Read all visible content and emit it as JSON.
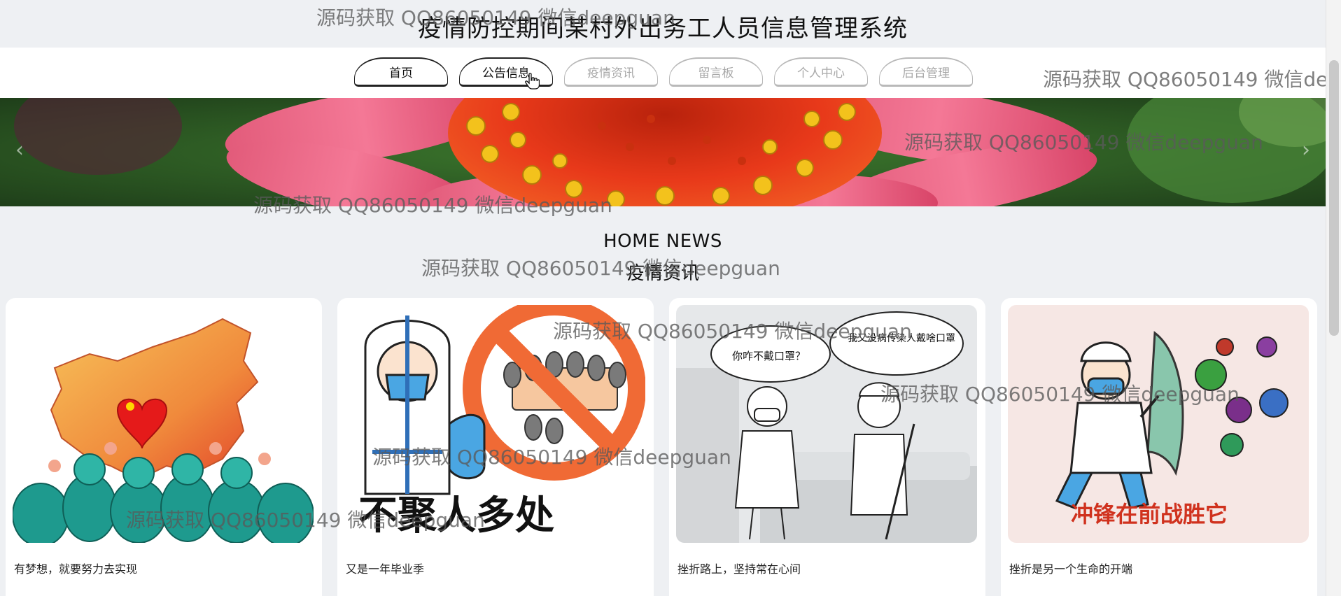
{
  "site": {
    "title": "疫情防控期间某村外出务工人员信息管理系统"
  },
  "nav": {
    "items": [
      {
        "label": "首页"
      },
      {
        "label": "公告信息"
      },
      {
        "label": "疫情资讯"
      },
      {
        "label": "留言板"
      },
      {
        "label": "个人中心"
      },
      {
        "label": "后台管理"
      }
    ]
  },
  "banner": {
    "prev_icon": "chevron-left-icon",
    "next_icon": "chevron-right-icon",
    "prev_glyph": "‹",
    "next_glyph": "›"
  },
  "section": {
    "heading_en": "HOME NEWS",
    "heading_cn": "疫情资讯"
  },
  "news": [
    {
      "caption": "有梦想，就要努力去实现",
      "image_text": ""
    },
    {
      "caption": "又是一年毕业季",
      "image_text": "不聚人多处"
    },
    {
      "caption": "挫折路上，坚持常在心间",
      "image_text_1": "你咋不戴口罩？",
      "image_text_2": "我又没病传染人戴啥口罩"
    },
    {
      "caption": "挫折是另一个生命的开端",
      "image_text": "冲锋在前战胜它"
    }
  ],
  "watermark": {
    "text": "源码获取 QQ86050149 微信deepguan"
  },
  "colors": {
    "page_bg": "#eef0f3",
    "nav_bg": "#ffffff",
    "active_border": "#222222",
    "inactive_border": "#b9b9b9"
  }
}
